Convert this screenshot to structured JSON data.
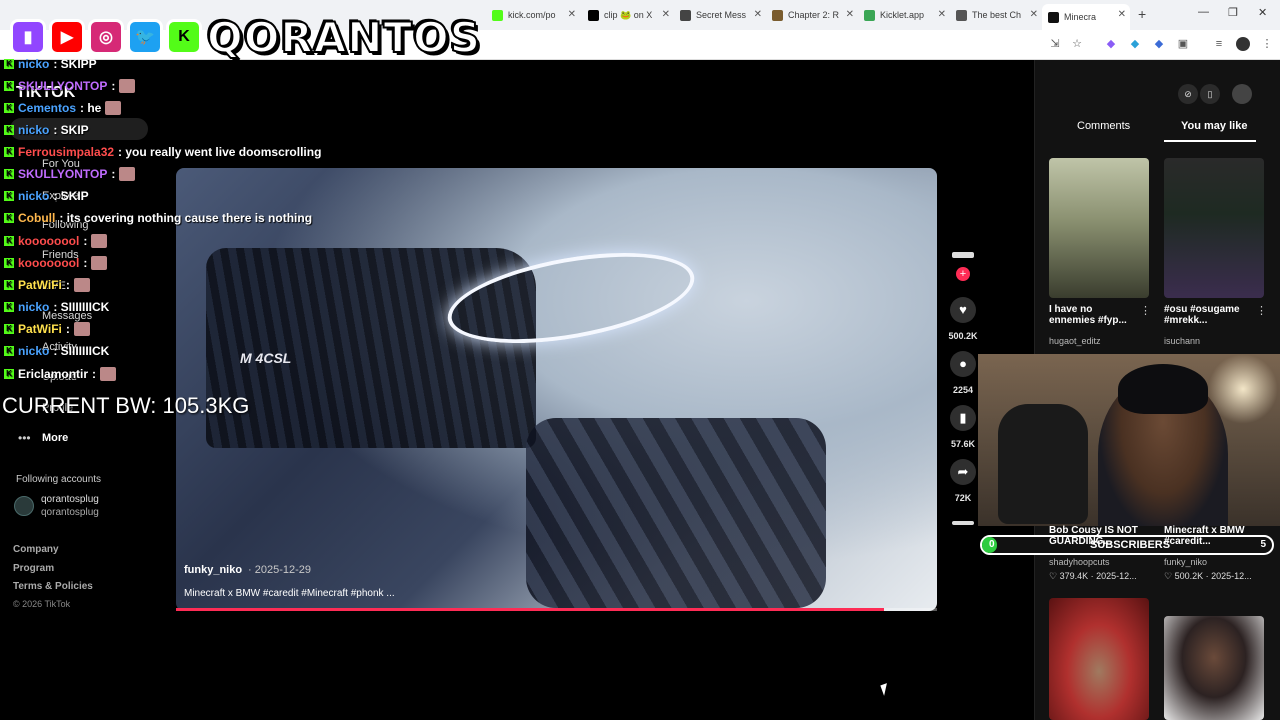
{
  "browser": {
    "tabs": [
      {
        "label": "kick.com/po",
        "color": "#53fc18"
      },
      {
        "label": "clip 🐸 on X",
        "color": "#000000"
      },
      {
        "label": "Secret Mess",
        "color": "#444444"
      },
      {
        "label": "Chapter 2: R",
        "color": "#7a5c2e"
      },
      {
        "label": "Kicklet.app",
        "color": "#3aa655"
      },
      {
        "label": "The best Ch",
        "color": "#555555"
      },
      {
        "label": "Minecra",
        "color": "#111111"
      }
    ],
    "new_tab": "+"
  },
  "overlay": {
    "streamer_name": "QORANTOS",
    "platforms": [
      {
        "icon": "twitch-icon",
        "glyph": "▮",
        "color": "#9146ff"
      },
      {
        "icon": "youtube-icon",
        "glyph": "▶",
        "color": "#ff0000"
      },
      {
        "icon": "instagram-icon",
        "glyph": "◎",
        "color": "#d62976"
      },
      {
        "icon": "twitter-icon",
        "glyph": "🐦",
        "color": "#1da1f2"
      },
      {
        "icon": "kick-icon",
        "glyph": "K",
        "color": "#53fc18"
      }
    ],
    "bw_text": "CURRENT BW: 105.3KG"
  },
  "tiktok_sidebar": {
    "logo": "TIKTOK",
    "nav": [
      "For You",
      "Explore",
      "Following",
      "Friends",
      "LIVE",
      "Messages",
      "Activity",
      "Upload",
      "Profile",
      "More"
    ],
    "following_heading": "Following accounts",
    "following_user": "qorantosplug",
    "following_handle": "qorantosplug",
    "footer": [
      "Company",
      "Program",
      "Terms & Policies",
      "© 2026 TikTok"
    ]
  },
  "chat": [
    {
      "user": "nicko",
      "color": "#4aa3ff",
      "msg": ": SKIPP"
    },
    {
      "user": "SKULLYONTOP",
      "color": "#c06cff",
      "msg": ":"
    },
    {
      "user": "Cementos",
      "color": "#4aa3ff",
      "msg": ": he"
    },
    {
      "user": "nicko",
      "color": "#4aa3ff",
      "msg": ": SKIP"
    },
    {
      "user": "Ferrousimpala32",
      "color": "#ff4d4d",
      "msg": ": you really went live doomscrolling"
    },
    {
      "user": "SKULLYONTOP",
      "color": "#c06cff",
      "msg": ":"
    },
    {
      "user": "nicko",
      "color": "#4aa3ff",
      "msg": ": SKIP"
    },
    {
      "user": "Cobull",
      "color": "#ffb84d",
      "msg": ": its covering nothing cause there is nothing"
    },
    {
      "user": "koooooool",
      "color": "#ff4d4d",
      "msg": ":"
    },
    {
      "user": "koooooool",
      "color": "#ff4d4d",
      "msg": ":"
    },
    {
      "user": "PatWiFi",
      "color": "#ffe14d",
      "msg": ":"
    },
    {
      "user": "nicko",
      "color": "#4aa3ff",
      "msg": ": SIIIIIIICK"
    },
    {
      "user": "PatWiFi",
      "color": "#ffe14d",
      "msg": ":"
    },
    {
      "user": "nicko",
      "color": "#4aa3ff",
      "msg": ": SIIIIIIICK"
    },
    {
      "user": "Ericlamontir",
      "color": "#ffffff",
      "msg": ":"
    }
  ],
  "video": {
    "author": "funky_niko",
    "date": "· 2025-12-29",
    "caption": "Minecraft x BMW #caredit #Minecraft #phonk ...",
    "badge": "M 4CSL",
    "progress_pct": 93
  },
  "actions": [
    {
      "icon": "heart-icon",
      "glyph": "♥",
      "count": "500.2K"
    },
    {
      "icon": "comment-icon",
      "glyph": "●",
      "count": "2254"
    },
    {
      "icon": "bookmark-icon",
      "glyph": "▮",
      "count": "57.6K"
    },
    {
      "icon": "share-icon",
      "glyph": "➦",
      "count": "72K"
    }
  ],
  "right_panel": {
    "tab_comments": "Comments",
    "tab_you_may_like": "You may like",
    "cards": [
      {
        "title": "I have no ennemies #fyp...",
        "author": "hugaot_editz",
        "stats": ""
      },
      {
        "title": "#osu #osugame #mrekk...",
        "author": "isuchann",
        "stats": ""
      },
      {
        "title": "Bob Cousy IS NOT GUARDING...",
        "author": "shadyhoopcuts",
        "stats": "♡ 379.4K · 2025-12..."
      },
      {
        "title": "Minecraft x BMW #caredit...",
        "author": "funky_niko",
        "stats": "♡ 500.2K · 2025-12..."
      }
    ]
  },
  "subscriber_bar": {
    "label": "SUBSCRIBERS",
    "current": "0",
    "goal": "5",
    "progress_pct": 4
  }
}
